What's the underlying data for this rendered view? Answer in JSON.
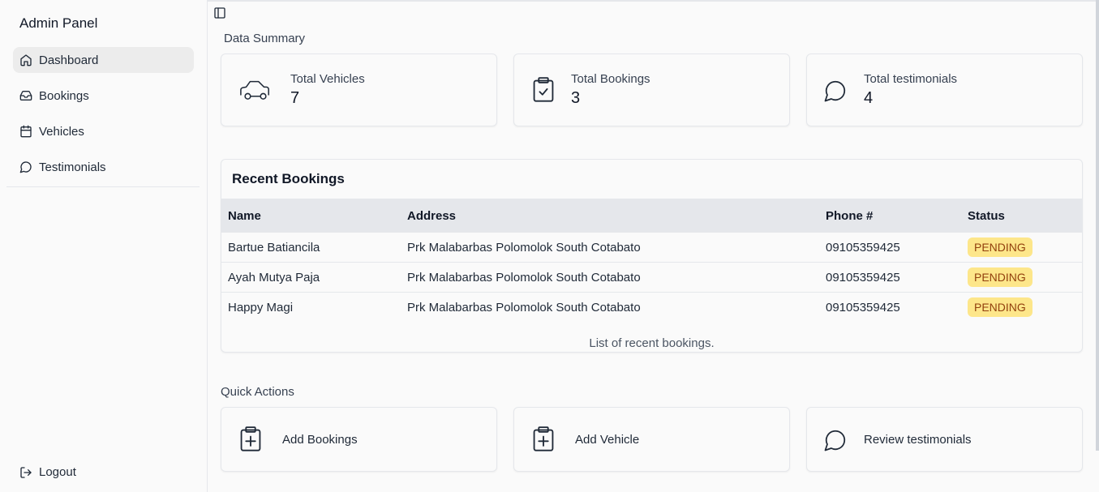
{
  "app": {
    "title": "Admin Panel"
  },
  "sidebar": {
    "items": [
      {
        "label": "Dashboard",
        "icon": "home-icon",
        "active": true
      },
      {
        "label": "Bookings",
        "icon": "inbox-icon",
        "active": false
      },
      {
        "label": "Vehicles",
        "icon": "calendar-icon",
        "active": false
      },
      {
        "label": "Testimonials",
        "icon": "message-circle-icon",
        "active": false
      }
    ],
    "logout_label": "Logout"
  },
  "summary": {
    "title": "Data Summary",
    "cards": [
      {
        "label": "Total Vehicles",
        "value": "7",
        "icon": "car-icon"
      },
      {
        "label": "Total Bookings",
        "value": "3",
        "icon": "clipboard-check-icon"
      },
      {
        "label": "Total testimonials",
        "value": "4",
        "icon": "message-circle-icon"
      }
    ]
  },
  "recent_bookings": {
    "title": "Recent Bookings",
    "columns": [
      "Name",
      "Address",
      "Phone #",
      "Status"
    ],
    "rows": [
      {
        "name": "Bartue Batiancila",
        "address": "Prk Malabarbas Polomolok South Cotabato",
        "phone": "09105359425",
        "status": "PENDING"
      },
      {
        "name": "Ayah Mutya Paja",
        "address": "Prk Malabarbas Polomolok South Cotabato",
        "phone": "09105359425",
        "status": "PENDING"
      },
      {
        "name": "Happy Magi",
        "address": "Prk Malabarbas Polomolok South Cotabato",
        "phone": "09105359425",
        "status": "PENDING"
      }
    ],
    "caption": "List of recent bookings."
  },
  "quick_actions": {
    "title": "Quick Actions",
    "items": [
      {
        "label": "Add Bookings",
        "icon": "clipboard-plus-icon"
      },
      {
        "label": "Add Vehicle",
        "icon": "clipboard-plus-icon"
      },
      {
        "label": "Review testimonials",
        "icon": "message-circle-icon"
      }
    ]
  },
  "colors": {
    "badge_bg": "#fde68a",
    "badge_text": "#92400e",
    "active_nav_bg": "#ececec",
    "table_header_bg": "#e5e7eb"
  }
}
